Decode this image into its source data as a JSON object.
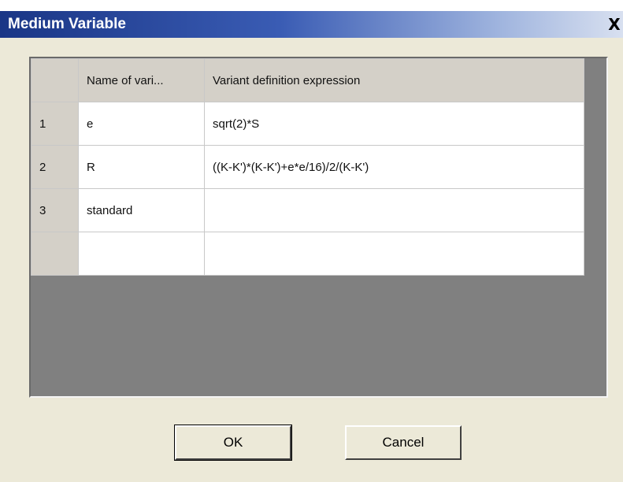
{
  "window": {
    "title": "Medium Variable",
    "close_label": "X"
  },
  "grid": {
    "columns": [
      "",
      "Name of vari...",
      "Variant definition expression"
    ],
    "rows": [
      {
        "num": "1",
        "name": "e",
        "expression": "sqrt(2)*S"
      },
      {
        "num": "2",
        "name": "R",
        "expression": "((K-K')*(K-K')+e*e/16)/2/(K-K')"
      },
      {
        "num": "3",
        "name": "standard",
        "expression": ""
      },
      {
        "num": "",
        "name": "",
        "expression": ""
      }
    ]
  },
  "buttons": {
    "ok_label": "OK",
    "cancel_label": "Cancel"
  }
}
